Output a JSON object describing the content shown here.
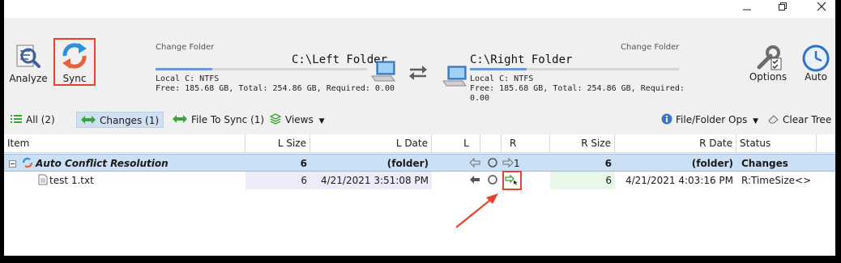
{
  "toolbar": {
    "analyze_label": "Analyze",
    "sync_label": "Sync",
    "options_label": "Options",
    "auto_label": "Auto",
    "left": {
      "change_folder": "Change Folder",
      "path": "C:\\Left Folder",
      "drive": "Local C: NTFS",
      "space": "Free: 185.68 GB, Total: 254.86 GB, Required: 0.00",
      "usage_fraction": 0.27
    },
    "right": {
      "change_folder": "Change Folder",
      "path": "C:\\Right Folder",
      "drive": "Local C: NTFS",
      "space_line1": "Free: 185.68 GB, Total: 254.86 GB, Required:",
      "space_line2": "0.00",
      "usage_fraction": 0.27
    }
  },
  "filters": {
    "all": "All (2)",
    "changes": "Changes (1)",
    "file_to_sync": "File To Sync (1)",
    "views": "Views",
    "file_folder_ops": "File/Folder Ops",
    "clear_tree": "Clear Tree"
  },
  "grid": {
    "headers": {
      "item": "Item",
      "l_size": "L Size",
      "l_date": "L Date",
      "l": "L",
      "r": "R",
      "r_size": "R Size",
      "r_date": "R Date",
      "status": "Status"
    },
    "rows": [
      {
        "item": "Auto Conflict Resolution",
        "l_size": "6",
        "l_date": "(folder)",
        "r_count": "1",
        "r_size": "6",
        "r_date": "(folder)",
        "status": "Changes"
      },
      {
        "item": "test 1.txt",
        "l_size": "6",
        "l_date": "4/21/2021 3:51:08 PM",
        "r_size": "6",
        "r_date": "4/21/2021 4:03:16 PM",
        "status": "R:TimeSize<>"
      }
    ]
  },
  "colors": {
    "highlight": "#e8422a",
    "selected_row": "#cce0f5",
    "left_cell_bg": "#ecebf8",
    "right_cell_bg": "#e8f7e8",
    "accent_blue": "#3a78c2",
    "accent_green": "#3aa33a"
  }
}
